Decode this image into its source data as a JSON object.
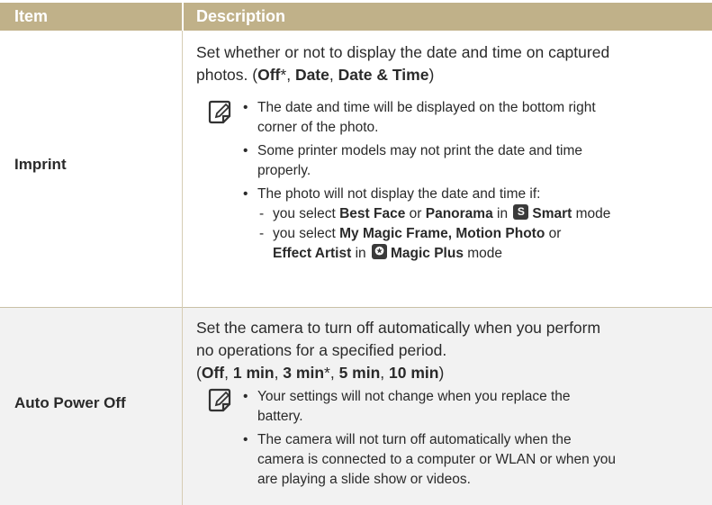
{
  "header": {
    "item": "Item",
    "description": "Description"
  },
  "rows": [
    {
      "item": "Imprint",
      "desc_line1": "Set whether or not to display the date and time on captured",
      "desc_line2_prefix": "photos. (",
      "opt1": "Off",
      "star1": "*",
      "comma1": ", ",
      "opt2": "Date",
      "comma2": ", ",
      "opt3": "Date & Time",
      "close": ")",
      "note_icon": "note-pencil-icon",
      "bullets": {
        "b1_l1": "The date and time will be displayed on the bottom right",
        "b1_l2": "corner of the photo.",
        "b2_l1": "Some printer models may not print the date and time",
        "b2_l2": "properly.",
        "b3": "The photo will not display the date and time if:",
        "s1_pre": "you select ",
        "s1_b1": "Best Face",
        "s1_or": " or ",
        "s1_b2": "Panorama",
        "s1_in": " in ",
        "s1_icon": "S",
        "s1_mode": "Smart",
        "s1_post": " mode",
        "s2_pre": "you select ",
        "s2_b1": "My Magic Frame, Motion Photo",
        "s2_or": " or",
        "s2_b2": "Effect Artist",
        "s2_in": " in ",
        "s2_icon": "✪",
        "s2_mode": "Magic Plus",
        "s2_post": " mode"
      }
    },
    {
      "item": "Auto Power Off",
      "desc_line1": "Set the camera to turn off automatically when you perform",
      "desc_line2": "no operations for a specified period.",
      "open": "(",
      "o1": "Off",
      "c1": ", ",
      "o2": "1 min",
      "c2": ", ",
      "o3": "3 min",
      "star": "*",
      "c3": ", ",
      "o4": "5 min",
      "c4": ", ",
      "o5": "10 min",
      "close": ")",
      "note_icon": "note-pencil-icon",
      "bullets": {
        "b1_l1": "Your settings will not change when you replace the",
        "b1_l2": "battery.",
        "b2_l1": "The camera will not turn off automatically when the",
        "b2_l2": "camera is connected to a computer or WLAN or when you",
        "b2_l3": "are playing a slide show or videos."
      }
    }
  ]
}
